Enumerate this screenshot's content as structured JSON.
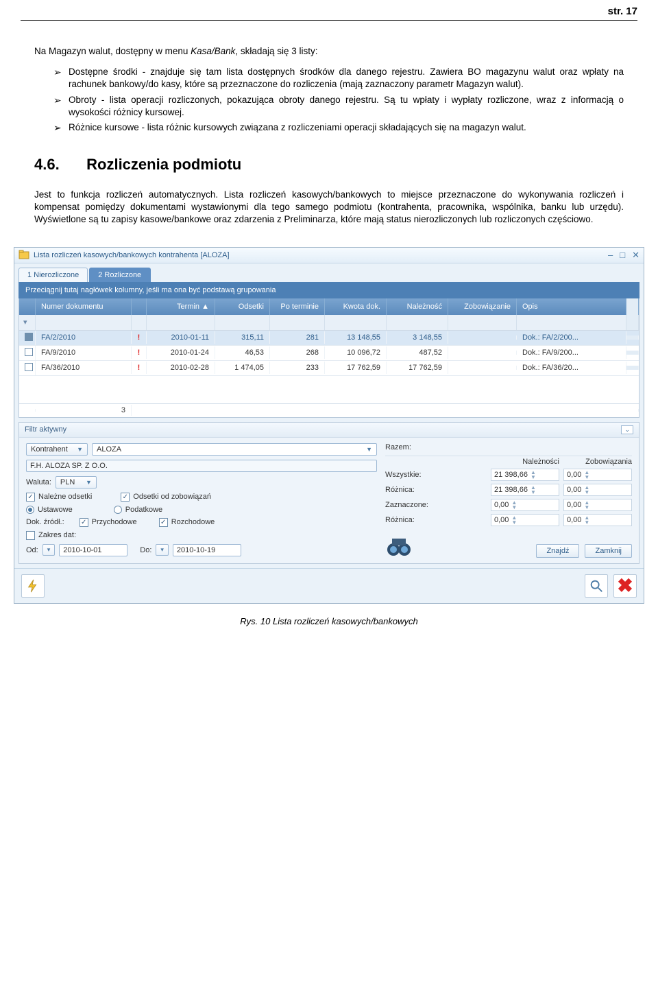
{
  "page_number": "str. 17",
  "doc": {
    "para1_pre": "Na Magazyn walut, dostępny w menu ",
    "para1_italic": "Kasa/Bank",
    "para1_post": ", składają się 3 listy:",
    "bullets": [
      "Dostępne środki - znajduje się tam lista dostępnych środków dla danego rejestru. Zawiera BO magazynu walut oraz wpłaty na rachunek bankowy/do kasy, które są przeznaczone do rozliczenia (mają zaznaczony parametr Magazyn walut).",
      "Obroty - lista operacji rozliczonych, pokazująca obroty danego rejestru. Są tu wpłaty i wypłaty rozliczone, wraz z informacją o wysokości różnicy kursowej.",
      "Różnice kursowe - lista różnic kursowych związana z rozliczeniami operacji składających się na magazyn walut."
    ],
    "section_num": "4.6.",
    "section_title": "Rozliczenia podmiotu",
    "para2": "Jest to funkcja rozliczeń automatycznych. Lista rozliczeń kasowych/bankowych to miejsce przeznaczone do wykonywania rozliczeń i kompensat pomiędzy dokumentami wystawionymi dla tego samego podmiotu (kontrahenta, pracownika, wspólnika, banku lub urzędu). Wyświetlone są tu zapisy kasowe/bankowe oraz zdarzenia z Preliminarza, które mają status nierozliczonych lub rozliczonych częściowo."
  },
  "window": {
    "title": "Lista rozliczeń kasowych/bankowych kontrahenta [ALOZA]",
    "tabs": [
      {
        "label": "1 Nierozliczone",
        "active": false
      },
      {
        "label": "2 Rozliczone",
        "active": true
      }
    ],
    "groupbar": "Przeciągnij tutaj nagłówek kolumny, jeśli ma ona być podstawą grupowania",
    "columns": [
      "Numer dokumentu",
      "Termin ▲",
      "Odsetki",
      "Po terminie",
      "Kwota dok.",
      "Należność",
      "Zobowiązanie",
      "Opis"
    ],
    "rows": [
      {
        "sel": true,
        "num": "FA/2/2010",
        "term": "2010-01-11",
        "ods": "315,11",
        "pot": "281",
        "kw": "13 148,55",
        "nal": "3 148,55",
        "zob": "",
        "opis": "Dok.: FA/2/200..."
      },
      {
        "sel": false,
        "num": "FA/9/2010",
        "term": "2010-01-24",
        "ods": "46,53",
        "pot": "268",
        "kw": "10 096,72",
        "nal": "487,52",
        "zob": "",
        "opis": "Dok.: FA/9/200..."
      },
      {
        "sel": false,
        "num": "FA/36/2010",
        "term": "2010-02-28",
        "ods": "1 474,05",
        "pot": "233",
        "kw": "17 762,59",
        "nal": "17 762,59",
        "zob": "",
        "opis": "Dok.: FA/36/20..."
      }
    ],
    "sum_count": "3",
    "filter": {
      "label": "Filtr aktywny",
      "kontrahent_lbl": "Kontrahent",
      "kontrahent_val": "ALOZA",
      "kontrahent_name": "F.H. ALOZA SP. Z O.O.",
      "waluta_lbl": "Waluta:",
      "waluta_val": "PLN",
      "nal_ods": "Należne odsetki",
      "ods_zob": "Odsetki od zobowiązań",
      "ustawowe": "Ustawowe",
      "podatkowe": "Podatkowe",
      "dok_zrodl": "Dok. źródł.:",
      "przychodowe": "Przychodowe",
      "rozchodowe": "Rozchodowe",
      "zakres": "Zakres dat:",
      "od": "Od:",
      "od_val": "2010-10-01",
      "do": "Do:",
      "do_val": "2010-10-19",
      "razem": "Razem:",
      "hdr_nal": "Należności",
      "hdr_zob": "Zobowiązania",
      "wszystkie": "Wszystkie:",
      "wszystkie_n": "21 398,66",
      "wszystkie_z": "0,00",
      "roznica1": "Różnica:",
      "roznica1_v": "21 398,66",
      "roznica1_z": "0,00",
      "zazn": "Zaznaczone:",
      "zazn_n": "0,00",
      "zazn_z": "0,00",
      "roznica2": "Różnica:",
      "roznica2_n": "0,00",
      "roznica2_z": "0,00",
      "znajdz": "Znajdź",
      "zamknij": "Zamknij"
    }
  },
  "caption": "Rys. 10 Lista rozliczeń kasowych/bankowych"
}
